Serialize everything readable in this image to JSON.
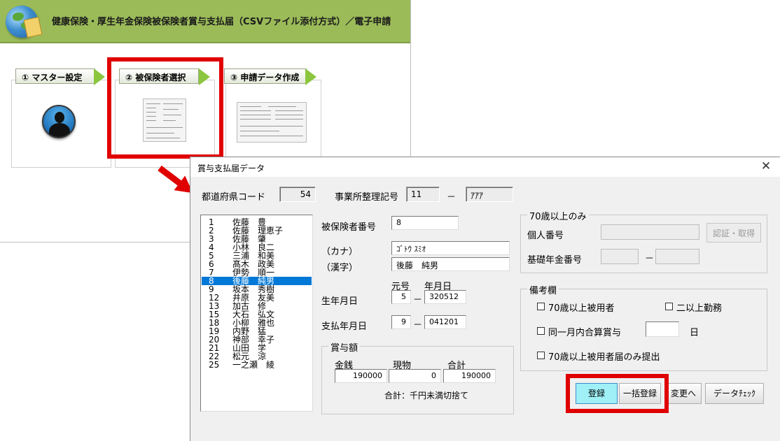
{
  "app": {
    "title": "健康保険・厚生年金保険被保険者賞与支払届（CSVファイル添付方式）／電子申請"
  },
  "steps": [
    {
      "label": "① マスター設定"
    },
    {
      "label": "② 被保険者選択"
    },
    {
      "label": "③ 申請データ作成"
    }
  ],
  "dialog": {
    "title": "賞与支払届データ",
    "close": "✕",
    "prefecture_code_label": "都道府県コード",
    "prefecture_code": "54",
    "office_code_label": "事業所整理記号",
    "office_code_1": "11",
    "office_code_dash": "－",
    "office_code_2": "ｱｱｱ",
    "insured_list": [
      {
        "no": "1",
        "name": "佐藤　豊"
      },
      {
        "no": "2",
        "name": "佐藤　理恵子"
      },
      {
        "no": "3",
        "name": "佐藤　肇"
      },
      {
        "no": "4",
        "name": "小林　良二"
      },
      {
        "no": "5",
        "name": "三浦　和美"
      },
      {
        "no": "6",
        "name": "髙木　政美"
      },
      {
        "no": "7",
        "name": "伊勢　順一"
      },
      {
        "no": "8",
        "name": "後藤　純男"
      },
      {
        "no": "9",
        "name": "坂本　秀樹"
      },
      {
        "no": "12",
        "name": "井原　友美"
      },
      {
        "no": "13",
        "name": "加古　修"
      },
      {
        "no": "15",
        "name": "大石　弘文"
      },
      {
        "no": "18",
        "name": "小柳　雅也"
      },
      {
        "no": "19",
        "name": "内野　猛"
      },
      {
        "no": "20",
        "name": "神部　幸子"
      },
      {
        "no": "21",
        "name": "山田　学"
      },
      {
        "no": "22",
        "name": "松元　涼"
      },
      {
        "no": "25",
        "name": "一之瀬　綾"
      }
    ],
    "selected_index": 7,
    "insured_no_label": "被保険者番号",
    "insured_no": "8",
    "kana_label": "（カナ）",
    "kana_value": "ｺﾞﾄｳ ｽﾐｵ",
    "kanji_label": "（漢字）",
    "kanji_value": "後藤　純男",
    "era_label": "元号",
    "ymd_label": "年月日",
    "birth_label": "生年月日",
    "birth_era": "5",
    "birth_date": "320512",
    "dash": "－",
    "pay_date_label": "支払年月日",
    "pay_era": "9",
    "pay_date": "041201",
    "bonus": {
      "group_label": "賞与額",
      "cash_label": "金銭",
      "goods_label": "現物",
      "total_label": "合計",
      "cash": "190000",
      "goods": "0",
      "total": "190000",
      "note": "合計：千円未満切捨て"
    },
    "over70": {
      "group_label": "70歳以上のみ",
      "personal_no_label": "個人番号",
      "auth_button": "認証・取得",
      "pension_no_label": "基礎年金番号",
      "dash": "－"
    },
    "remarks": {
      "group_label": "備考欄",
      "opt1": "70歳以上被用者",
      "opt2": "二以上勤務",
      "opt3": "同一月内合算賞与",
      "day_unit": "日",
      "opt4": "70歳以上被用者届のみ提出"
    },
    "buttons": {
      "register": "登録",
      "bulk_register": "一括登録",
      "change": "変更へ",
      "data_check": "データﾁｪｯｸ"
    }
  },
  "colors": {
    "banner": "#9bbb59",
    "highlight": "#e00000",
    "selection": "#0078d7",
    "primary_button": "#9ff0f7"
  }
}
